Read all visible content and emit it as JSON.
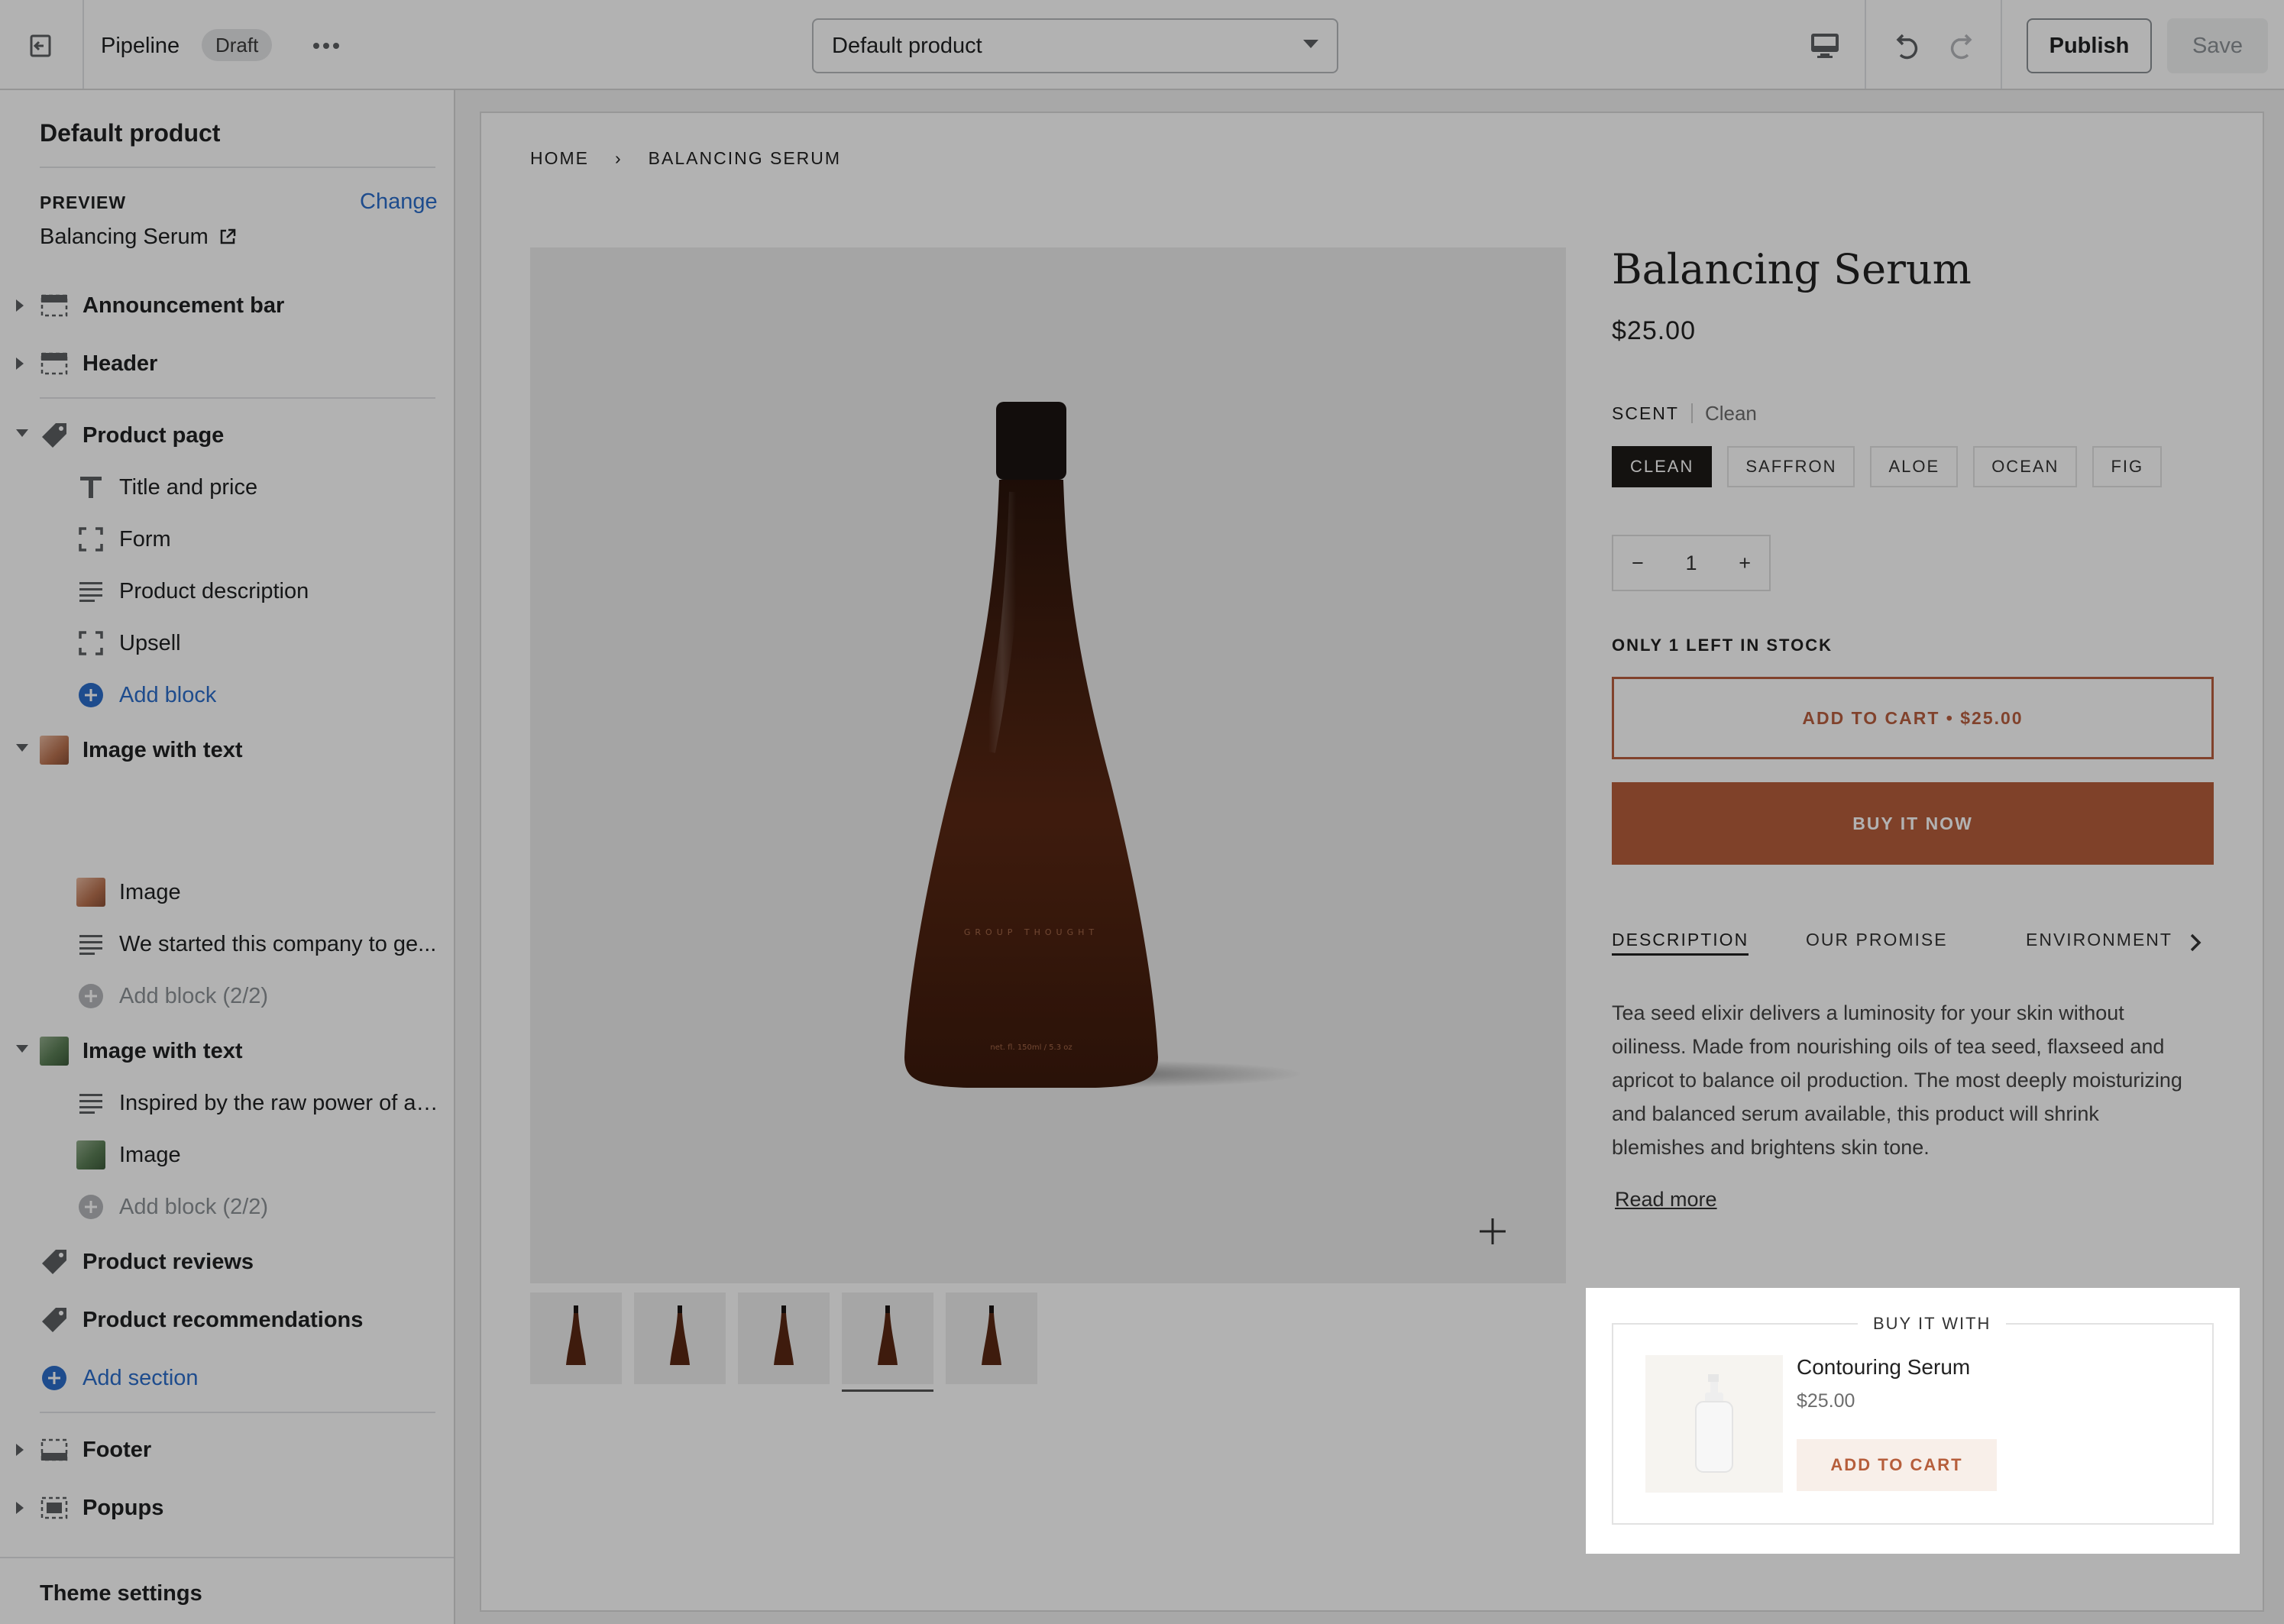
{
  "topbar": {
    "exit_label": "Exit",
    "theme_name": "Pipeline",
    "status_badge": "Draft",
    "more_label": "More actions",
    "template_select": "Default product",
    "device_label": "Desktop",
    "undo_label": "Undo",
    "redo_label": "Redo",
    "publish_label": "Publish",
    "save_label": "Save"
  },
  "sidebar": {
    "title": "Default product",
    "preview_label": "PREVIEW",
    "change_label": "Change",
    "preview_value": "Balancing Serum",
    "sections": {
      "announcement": "Announcement bar",
      "header": "Header",
      "product_page": "Product page",
      "title_price": "Title and price",
      "form": "Form",
      "product_description": "Product description",
      "upsell": "Upsell",
      "add_block": "Add block",
      "image_text_1": "Image with text",
      "image_1": "Image",
      "text_1": "We started this company to ge...",
      "add_block_1": "Add block (2/2)",
      "image_text_2": "Image with text",
      "text_2": "Inspired by the raw power of a ...",
      "image_2": "Image",
      "add_block_2": "Add block (2/2)",
      "product_reviews": "Product reviews",
      "product_recommendations": "Product recommendations",
      "add_section": "Add section",
      "footer": "Footer",
      "popups": "Popups"
    },
    "theme_settings": "Theme settings"
  },
  "preview": {
    "breadcrumb": [
      "HOME",
      "›",
      "BALANCING SERUM"
    ],
    "product_title": "Balancing Serum",
    "price": "$25.00",
    "bottle_brand": "GROUP THOUGHT",
    "bottle_volume": "net. fl. 150ml / 5.3 oz",
    "scent_label": "SCENT",
    "scent_value": "Clean",
    "scent_options": [
      "CLEAN",
      "SAFFRON",
      "ALOE",
      "OCEAN",
      "FIG"
    ],
    "qty_minus": "−",
    "quantity": "1",
    "qty_plus": "+",
    "stock_note": "ONLY 1 LEFT IN STOCK",
    "add_to_cart": "ADD TO CART • $25.00",
    "buy_now": "BUY IT NOW",
    "tabs": [
      "DESCRIPTION",
      "OUR PROMISE",
      "ENVIRONMENT"
    ],
    "description": "Tea seed elixir delivers a luminosity for your skin without oiliness. Made from nourishing oils of tea seed, flaxseed and apricot to balance oil production.  The most deeply moisturizing and balanced serum available, this product will shrink blemishes and brightens skin tone.",
    "read_more": "Read more",
    "upsell": {
      "heading": "BUY IT WITH",
      "product_name": "Contouring Serum",
      "product_price": "$25.00",
      "add_to_cart": "ADD TO CART"
    }
  },
  "colors": {
    "accent_link": "#2c6ecb",
    "brand_terracotta": "#b65e3b",
    "selected_swatch": "#1e1a17",
    "bottle_amber": "#5a2814"
  }
}
